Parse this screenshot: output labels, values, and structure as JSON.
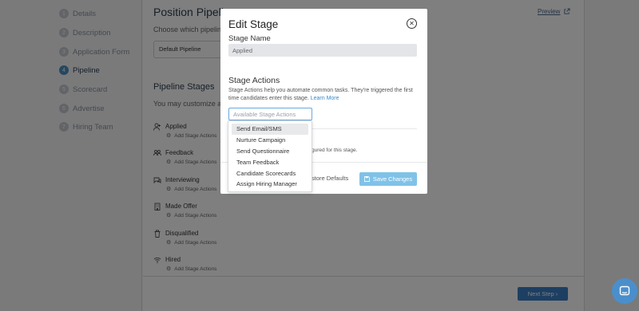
{
  "steps": [
    {
      "num": "1",
      "label": "Details"
    },
    {
      "num": "2",
      "label": "Description"
    },
    {
      "num": "3",
      "label": "Application Form"
    },
    {
      "num": "4",
      "label": "Pipeline"
    },
    {
      "num": "5",
      "label": "Scorecard"
    },
    {
      "num": "6",
      "label": "Advertise"
    },
    {
      "num": "7",
      "label": "Hiring Team"
    }
  ],
  "main": {
    "title": "Position Pipeline",
    "preview_label": "Preview",
    "choose_text": "Choose which pipeline",
    "pipeline_select_value": "Default Pipeline",
    "stages_title": "Pipeline Stages",
    "stages_sub": "You may customize a",
    "add_actions_label": "Add Stage Actions",
    "stages": [
      {
        "name": "Applied",
        "icon": "user-plus-icon"
      },
      {
        "name": "Feedback",
        "icon": "group-icon"
      },
      {
        "name": "Interviewing",
        "icon": "chat-icon"
      },
      {
        "name": "Made Offer",
        "icon": "building-icon"
      },
      {
        "name": "Disqualified",
        "icon": "trash-icon"
      },
      {
        "name": "Hired",
        "icon": "wifi-icon"
      }
    ],
    "next_label": "Next Step ›"
  },
  "modal": {
    "title": "Edit Stage",
    "stage_name_label": "Stage Name",
    "stage_name_value": "Applied",
    "actions_label": "Stage Actions",
    "actions_desc": "Stage Actions help you automate common tasks. They're triggered the first time candidates enter this stage.",
    "learn_more": "Learn More",
    "actions_placeholder": "Available Stage Actions",
    "configured_text": "gured for this stage.",
    "restore_label": "store Defaults",
    "save_label": "Save Changes"
  },
  "dropdown": {
    "items": [
      "Send Email/SMS",
      "Nurture Campaign",
      "Send Questionnaire",
      "Team Feedback",
      "Candidate Scorecards",
      "Assign Hiring Manager"
    ],
    "highlighted_index": 0
  },
  "colors": {
    "accent": "#3a7fc4",
    "save_button": "#7fc2e8",
    "link": "#3a8bc8"
  }
}
